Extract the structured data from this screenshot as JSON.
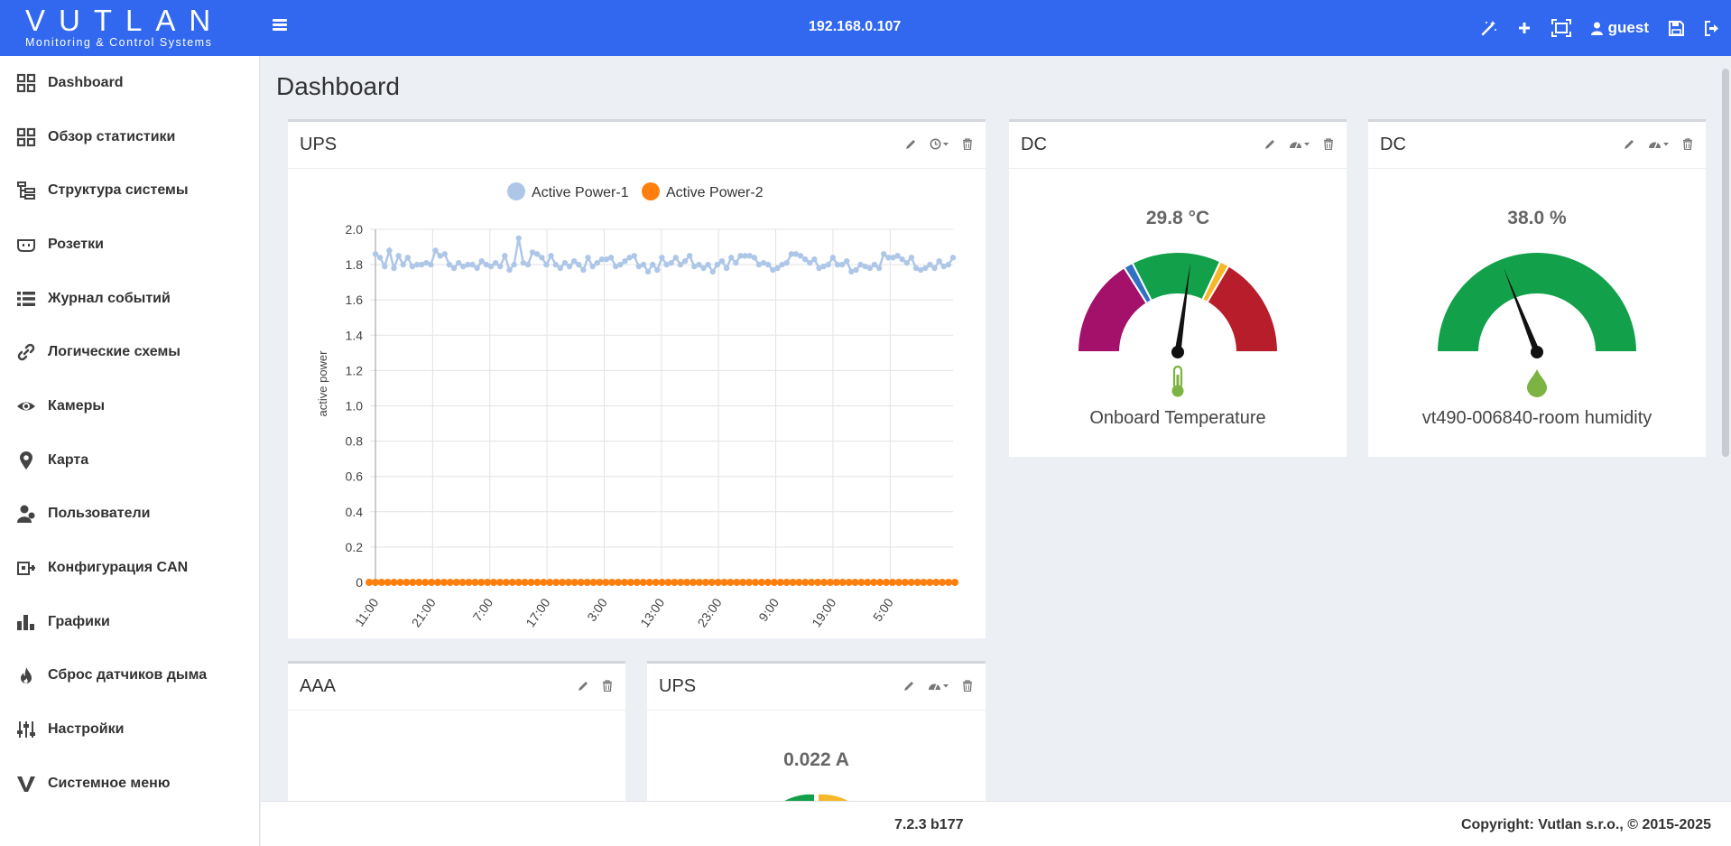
{
  "header": {
    "logo_title": "VUTLAN",
    "logo_subtitle": "Monitoring & Control Systems",
    "host": "192.168.0.107",
    "user": "guest",
    "icons": [
      "menu-icon",
      "wand-icon",
      "plus-icon",
      "fullscreen-icon",
      "user-icon",
      "save-icon",
      "logout-icon"
    ]
  },
  "sidebar": {
    "items": [
      {
        "label": "Dashboard",
        "icon": "grid-icon"
      },
      {
        "label": "Обзор статистики",
        "icon": "grid-icon"
      },
      {
        "label": "Структура системы",
        "icon": "tree-icon"
      },
      {
        "label": "Розетки",
        "icon": "outlet-icon"
      },
      {
        "label": "Журнал событий",
        "icon": "list-icon"
      },
      {
        "label": "Логические схемы",
        "icon": "link-icon"
      },
      {
        "label": "Камеры",
        "icon": "eye-icon"
      },
      {
        "label": "Карта",
        "icon": "map-marker-icon"
      },
      {
        "label": "Пользователи",
        "icon": "users-icon"
      },
      {
        "label": "Конфигурация CAN",
        "icon": "can-icon"
      },
      {
        "label": "Графики",
        "icon": "bar-chart-icon"
      },
      {
        "label": "Сброс датчиков дыма",
        "icon": "fire-icon"
      },
      {
        "label": "Настройки",
        "icon": "sliders-icon"
      },
      {
        "label": "Системное меню",
        "icon": "v-icon"
      }
    ]
  },
  "main": {
    "title": "Dashboard",
    "panels": {
      "ups_chart": {
        "title": "UPS"
      },
      "dc_temp": {
        "title": "DC",
        "value": "29.8 °C",
        "label": "Onboard Temperature",
        "level": 0.545
      },
      "dc_hum": {
        "title": "DC",
        "value": "38.0 %",
        "label": "vt490-006840-room humidity",
        "level": 0.38
      },
      "aaa": {
        "title": "AAA"
      },
      "ups_gauge": {
        "title": "UPS",
        "value": "0.022 A"
      }
    }
  },
  "chart_data": {
    "type": "line",
    "ylabel": "active power",
    "ylim": [
      0,
      2.0
    ],
    "yticks": [
      "0",
      "0.2",
      "0.4",
      "0.6",
      "0.8",
      "1.0",
      "1.2",
      "1.4",
      "1.6",
      "1.8",
      "2.0"
    ],
    "xticks": [
      "11:00",
      "21:00",
      "7:00",
      "17:00",
      "3:00",
      "13:00",
      "23:00",
      "9:00",
      "19:00",
      "5:00"
    ],
    "series": [
      {
        "name": "Active Power-1",
        "color": "#aec7e8",
        "values": [
          1.86,
          1.84,
          1.79,
          1.88,
          1.78,
          1.85,
          1.8,
          1.84,
          1.79,
          1.8,
          1.8,
          1.81,
          1.8,
          1.88,
          1.85,
          1.86,
          1.8,
          1.78,
          1.81,
          1.79,
          1.8,
          1.8,
          1.78,
          1.82,
          1.8,
          1.79,
          1.81,
          1.79,
          1.85,
          1.77,
          1.8,
          1.95,
          1.81,
          1.8,
          1.87,
          1.86,
          1.84,
          1.8,
          1.85,
          1.8,
          1.78,
          1.81,
          1.79,
          1.82,
          1.8,
          1.77,
          1.84,
          1.79,
          1.81,
          1.83,
          1.83,
          1.84,
          1.79,
          1.8,
          1.82,
          1.84,
          1.85,
          1.79,
          1.8,
          1.76,
          1.8,
          1.77,
          1.84,
          1.8,
          1.81,
          1.84,
          1.8,
          1.82,
          1.85,
          1.79,
          1.8,
          1.78,
          1.8,
          1.76,
          1.8,
          1.82,
          1.78,
          1.84,
          1.81,
          1.85,
          1.85,
          1.85,
          1.84,
          1.8,
          1.81,
          1.8,
          1.77,
          1.78,
          1.8,
          1.81,
          1.86,
          1.86,
          1.85,
          1.83,
          1.81,
          1.83,
          1.78,
          1.79,
          1.8,
          1.84,
          1.8,
          1.8,
          1.82,
          1.76,
          1.77,
          1.8,
          1.79,
          1.78,
          1.8,
          1.78,
          1.86,
          1.84,
          1.84,
          1.85,
          1.83,
          1.81,
          1.84,
          1.78,
          1.77,
          1.78,
          1.8,
          1.78,
          1.82,
          1.79,
          1.8,
          1.84
        ]
      },
      {
        "name": "Active Power-2",
        "color": "#ff7f0e",
        "values": "constant 0 across all samples"
      }
    ]
  },
  "footer": {
    "version": "7.2.3 b177",
    "copyright": "Copyright: Vutlan s.r.o., © 2015-2025"
  },
  "colors": {
    "header_bg": "#3168ef",
    "gauge_purple": "#a4116b",
    "gauge_blue": "#2f72c2",
    "gauge_green": "#13a04a",
    "gauge_yellow": "#f6b829",
    "gauge_red": "#b71d2b",
    "thermo_green": "#7cb342"
  }
}
